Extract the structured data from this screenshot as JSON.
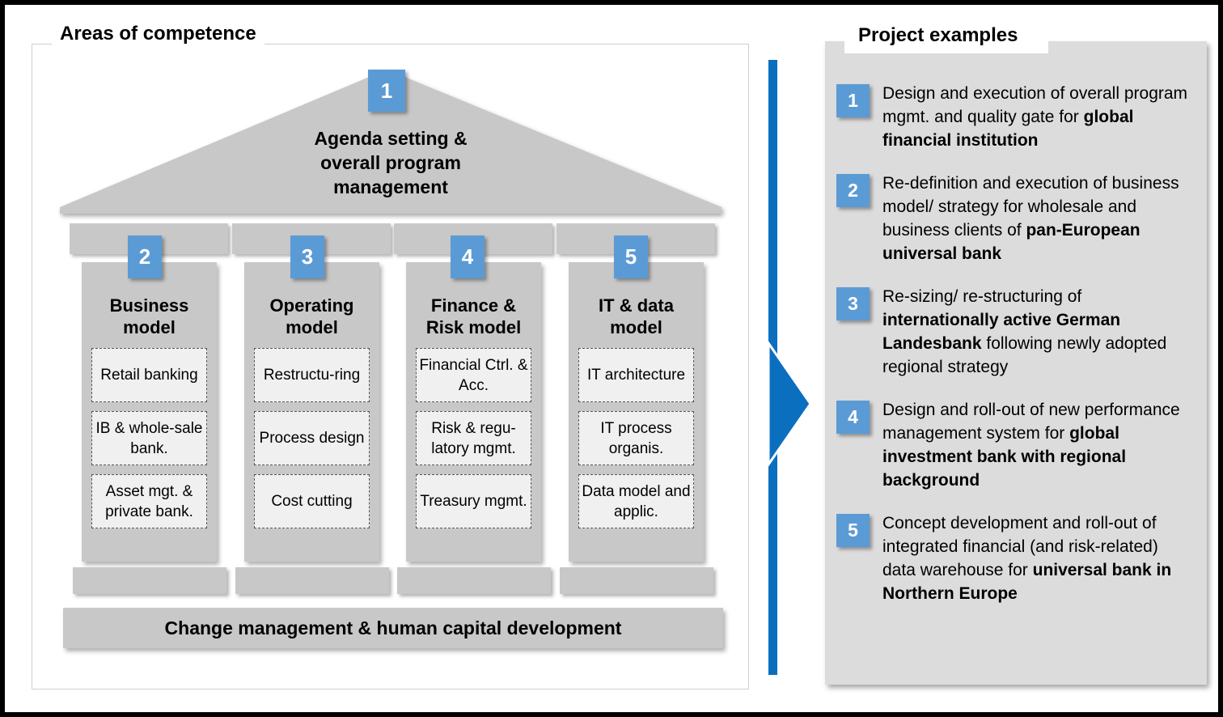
{
  "colors": {
    "badge_blue": "#5b9bd5",
    "arrow_blue": "#0b6fc0",
    "block_grey": "#c8c8c8",
    "panel_grey": "#dcdcdc",
    "subbox_grey": "#f0f0f0"
  },
  "left": {
    "title": "Areas of competence",
    "roof": {
      "badge": "1",
      "text_lines": [
        "Agenda setting &",
        "overall program",
        "management"
      ]
    },
    "pillars": [
      {
        "badge": "2",
        "title_lines": [
          "Business",
          "model"
        ],
        "items": [
          "Retail banking",
          "IB & whole-sale bank.",
          "Asset mgt. & private bank."
        ]
      },
      {
        "badge": "3",
        "title_lines": [
          "Operating",
          "model"
        ],
        "items": [
          "Restructu-ring",
          "Process design",
          "Cost cutting"
        ]
      },
      {
        "badge": "4",
        "title_lines": [
          "Finance &",
          "Risk model"
        ],
        "items": [
          "Financial Ctrl. & Acc.",
          "Risk & regu-latory mgmt.",
          "Treasury mgmt."
        ]
      },
      {
        "badge": "5",
        "title_lines": [
          "IT & data",
          "model"
        ],
        "items": [
          "IT architecture",
          "IT process organis.",
          "Data model and applic."
        ]
      }
    ],
    "bottom_bar": "Change management & human capital development"
  },
  "right": {
    "title": "Project examples",
    "examples": [
      {
        "number": "1",
        "text_html": "Design and execution of overall program mgmt. and quality gate for <b>global financial institution</b>"
      },
      {
        "number": "2",
        "text_html": "Re-definition and execution of business model/ strategy for wholesale and business clients of <b>pan-European universal bank</b>"
      },
      {
        "number": "3",
        "text_html": "Re-sizing/ re-structuring of <b>internationally active German Landesbank</b> following newly adopted regional strategy"
      },
      {
        "number": "4",
        "text_html": "Design and roll-out of new performance management system for <b>global investment bank with regional background</b>"
      },
      {
        "number": "5",
        "text_html": "Concept development and roll-out of integrated financial (and risk-related) data warehouse for <b>universal bank in Northern Europe</b>"
      }
    ]
  }
}
